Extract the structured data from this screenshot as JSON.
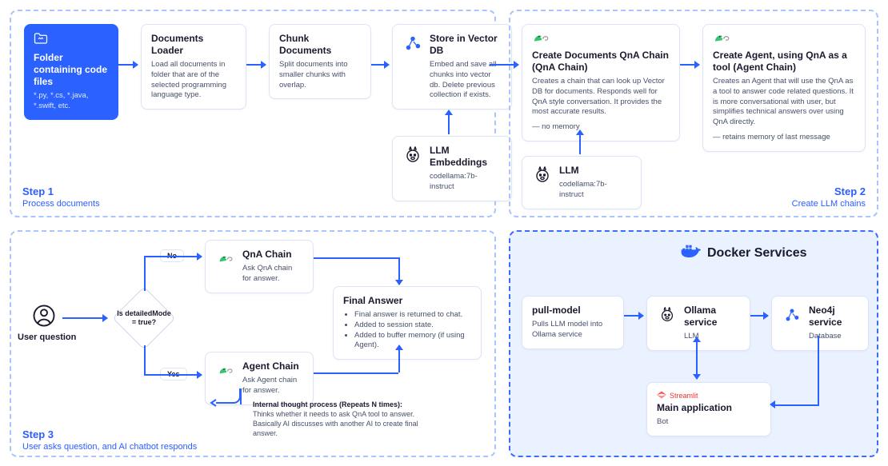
{
  "step1": {
    "label": "Step 1",
    "subtitle": "Process documents",
    "folder": {
      "title": "Folder containing code files",
      "caption": "*.py, *.cs, *.java, *.swift, etc."
    },
    "loader": {
      "title": "Documents Loader",
      "desc": "Load all documents in folder that are of the selected programming language type."
    },
    "chunk": {
      "title": "Chunk Documents",
      "desc": "Split documents into smaller chunks with overlap."
    },
    "vector": {
      "title": "Store in Vector DB",
      "desc": "Embed and save all chunks into vector db. Delete previous collection if exists."
    },
    "embed": {
      "title": "LLM Embeddings",
      "desc": "codellama:7b-instruct"
    }
  },
  "step2": {
    "label": "Step 2",
    "subtitle": "Create LLM chains",
    "qna": {
      "title": "Create Documents QnA Chain (QnA Chain)",
      "desc": "Creates a chain that can look up Vector DB for documents. Responds well for QnA style conversation. It provides the most accurate results.",
      "note": "— no memory"
    },
    "agent": {
      "title": "Create Agent, using QnA as a tool (Agent Chain)",
      "desc": "Creates an Agent that will use the QnA as a tool to answer code related questions. It is more conversational with user, but simplifies technical answers over using QnA directly.",
      "note": "— retains memory of last message"
    },
    "llm": {
      "title": "LLM",
      "desc": "codellama:7b-instruct"
    }
  },
  "step3": {
    "label": "Step 3",
    "subtitle": "User asks question, and AI chatbot responds",
    "user_label": "User question",
    "decision": "Is detailedMode = true?",
    "no": "No",
    "yes": "Yes",
    "qna_card": {
      "title": "QnA Chain",
      "desc": "Ask QnA chain for answer."
    },
    "agent_card": {
      "title": "Agent Chain",
      "desc": "Ask Agent chain for answer."
    },
    "final": {
      "title": "Final Answer",
      "b1": "Final answer is returned to chat.",
      "b2": "Added to session state.",
      "b3": "Added to buffer memory (if using Agent)."
    },
    "thought": {
      "heading": "Internal thought process (Repeats N times):",
      "body": "Thinks whether it needs to ask QnA tool to answer. Basically AI discusses with another AI to create final answer."
    }
  },
  "services": {
    "title": "Docker Services",
    "pull": {
      "title": "pull-model",
      "desc": "Pulls LLM model into Ollama service"
    },
    "ollama": {
      "title": "Ollama service",
      "desc": "LLM"
    },
    "neo4j": {
      "title": "Neo4j service",
      "desc": "Database"
    },
    "main": {
      "title": "Main application",
      "desc": "Bot",
      "tag": "Streamlit"
    }
  }
}
